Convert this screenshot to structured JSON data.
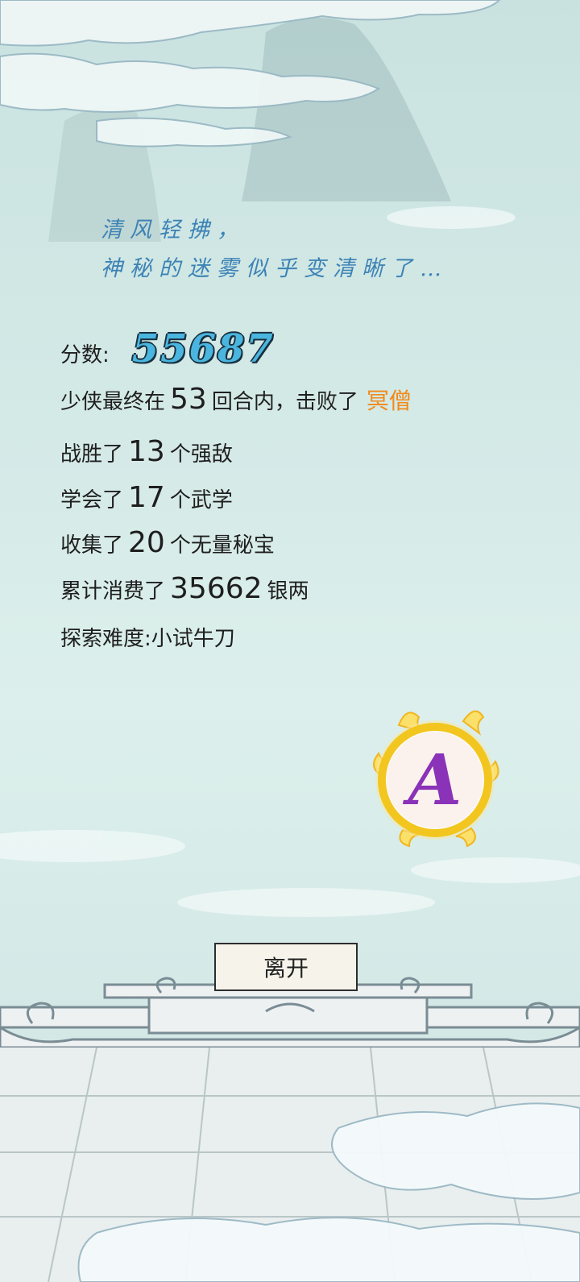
{
  "poem": {
    "line1": "清风轻拂，",
    "line2": "神秘的迷雾似乎变清晰了…"
  },
  "stats": {
    "score_label": "分数:",
    "score_value": "55687",
    "defeat_prefix": "少侠最终在",
    "rounds": "53",
    "defeat_middle": "回合内，击败了",
    "boss_name": "冥僧",
    "won_prefix": "战胜了",
    "won_count": "13",
    "won_suffix": "个强敌",
    "learned_prefix": "学会了",
    "learned_count": "17",
    "learned_suffix": "个武学",
    "collected_prefix": "收集了",
    "collected_count": "20",
    "collected_suffix": "个无量秘宝",
    "spent_prefix": "累计消费了",
    "spent_amount": "35662",
    "spent_suffix": "银两",
    "difficulty": "探索难度:小试牛刀"
  },
  "badge": {
    "grade": "A",
    "icon": "grade-a-flame-badge"
  },
  "leave_button": {
    "label": "离开"
  },
  "colors": {
    "sky": "#d3e9e6",
    "poem_text": "#3d83b5",
    "score_fill": "#4ab6df",
    "boss_name": "#f08a1a",
    "badge_ring": "#f2c61f",
    "badge_letter": "#8a32b8"
  }
}
